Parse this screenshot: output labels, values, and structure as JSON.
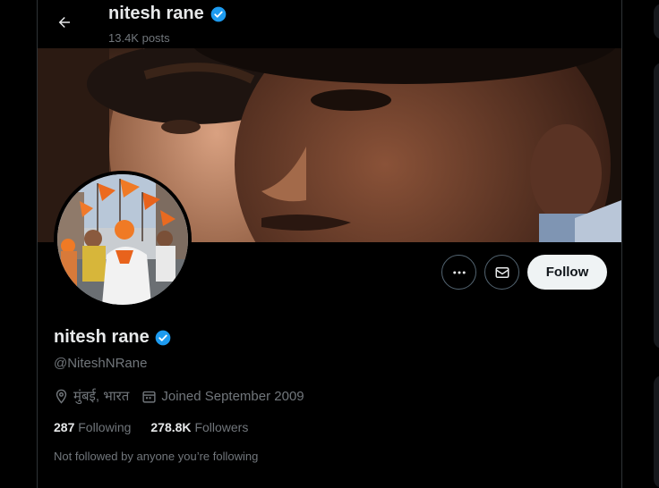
{
  "header": {
    "name": "nitesh rane",
    "posts_count": "13.4K posts"
  },
  "profile": {
    "name": "nitesh rane",
    "handle": "@NiteshNRane",
    "location": "मुंबई, भारत",
    "joined": "Joined September 2009",
    "following_count": "287",
    "following_label": "Following",
    "followers_count": "278.8K",
    "followers_label": "Followers",
    "not_followed_text": "Not followed by anyone you’re following"
  },
  "actions": {
    "follow_label": "Follow",
    "more_icon": "more-icon",
    "message_icon": "mail-icon"
  },
  "colors": {
    "verified": "#1d9bf0",
    "follow_bg": "#eff3f4",
    "muted_text": "#71767b"
  }
}
